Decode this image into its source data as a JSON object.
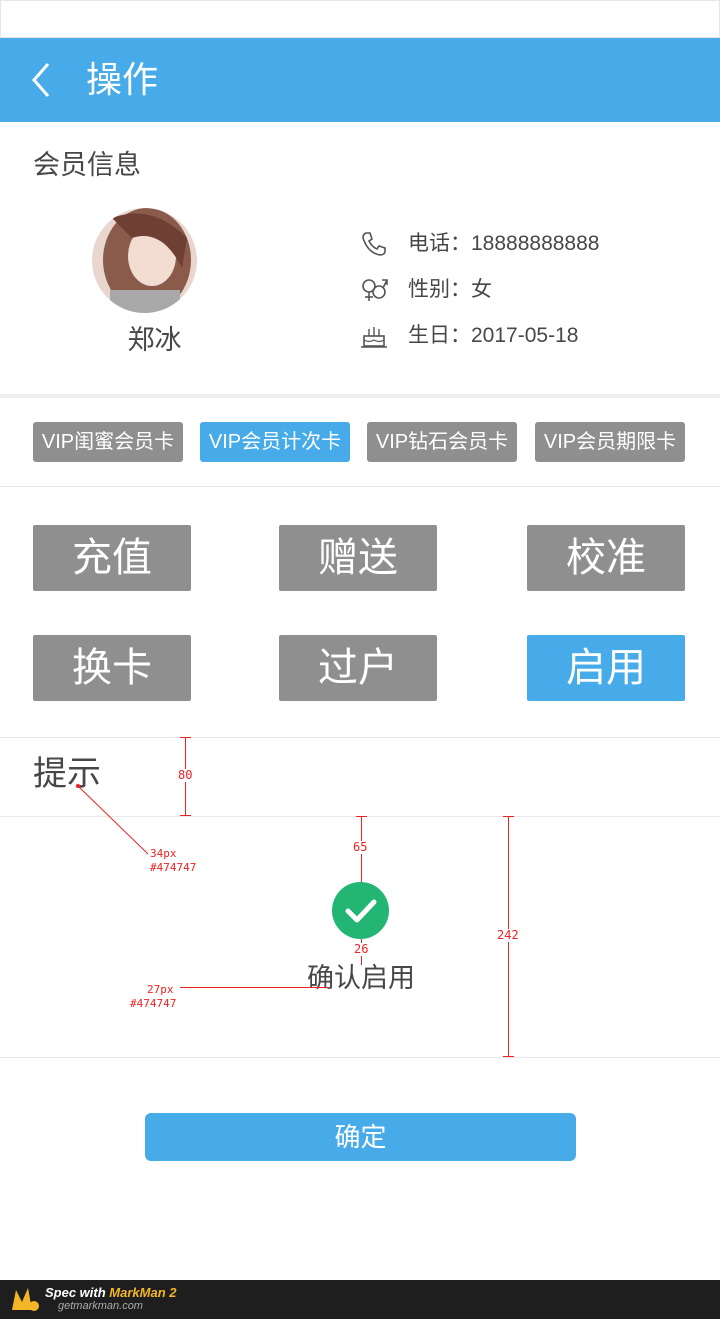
{
  "nav": {
    "title": "操作"
  },
  "member": {
    "section_title": "会员信息",
    "name": "郑冰",
    "phone": "电话：18888888888",
    "gender": "性别：女",
    "birthday": "生日：2017-05-18"
  },
  "cards": [
    {
      "label": "VIP闺蜜会员卡",
      "active": false
    },
    {
      "label": "VIP会员计次卡",
      "active": true
    },
    {
      "label": "VIP钻石会员卡",
      "active": false
    },
    {
      "label": "VIP会员期限卡",
      "active": false
    }
  ],
  "operations": [
    {
      "label": "充值",
      "active": false
    },
    {
      "label": "赠送",
      "active": false
    },
    {
      "label": "校准",
      "active": false
    },
    {
      "label": "换卡",
      "active": false
    },
    {
      "label": "过户",
      "active": false
    },
    {
      "label": "启用",
      "active": true
    }
  ],
  "tip": {
    "title": "提示",
    "message": "确认启用"
  },
  "confirm_button": "确定",
  "annotations": {
    "h80": "80",
    "h65": "65",
    "h26": "26",
    "h242": "242",
    "title_font": "34px",
    "title_color": "#474747",
    "msg_font": "27px",
    "msg_color": "#474747"
  },
  "footer": {
    "brand_prefix": "Spec with ",
    "brand_name": "MarkMan 2",
    "site": "getmarkman.com"
  },
  "colors": {
    "primary": "#47abe9",
    "inactive": "#8f8f8f",
    "success": "#22b573",
    "text": "#474747"
  }
}
